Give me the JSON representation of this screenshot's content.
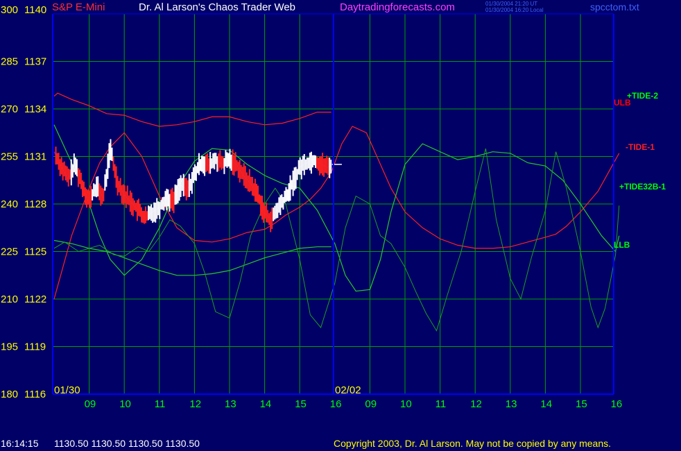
{
  "header": {
    "symbol": "S&P E-Mini",
    "title": "Dr. Al Larson's Chaos Trader Web",
    "site": "Daytradingforecasts.com",
    "ut_time": "01/30/2004 21:20 UT",
    "local_time": "01/30/2004 16:20 Local",
    "filename": "spcctom.txt"
  },
  "footer": {
    "time": "16:14:15",
    "quote": "1130.50 1130.50 1130.50 1130.50",
    "copyright": "Copyright 2003, Dr. Al Larson. May not be copied by any means."
  },
  "colors": {
    "background": "#000066",
    "grid": "#00a000",
    "price_up": "#ffffff",
    "price_down": "#ff2020",
    "tide": "#ff2020",
    "green_line": "#28c828",
    "osc": "#1e9e1e",
    "axis": "#0000ff"
  },
  "chart_data": {
    "type": "line",
    "y_left_labels": [
      "300",
      "285",
      "270",
      "255",
      "240",
      "225",
      "210",
      "195",
      "180"
    ],
    "y_right_labels": [
      "1140",
      "1137",
      "1134",
      "1131",
      "1128",
      "1125",
      "1122",
      "1119",
      "1116"
    ],
    "ylim": [
      1116,
      1140
    ],
    "x_ticks": [
      "09",
      "10",
      "11",
      "12",
      "13",
      "14",
      "15",
      "16",
      "09",
      "10",
      "11",
      "12",
      "13",
      "14",
      "15",
      "16"
    ],
    "date_labels": [
      "01/30",
      "02/02"
    ],
    "line_labels": [
      {
        "text": "+TIDE-2",
        "color": "#00ff00"
      },
      {
        "text": "ULB",
        "color": "#ff0000"
      },
      {
        "text": "-TIDE-1",
        "color": "#ff2020"
      },
      {
        "text": "+TIDE32B-1",
        "color": "#00ff00"
      },
      {
        "text": "LLB",
        "color": "#00ff00"
      }
    ],
    "series": [
      {
        "name": "ULB",
        "x": [
          0,
          0.1,
          0.5,
          1,
          1.5,
          2,
          2.5,
          3,
          3.5,
          4,
          4.5,
          5,
          5.5,
          6,
          6.5,
          7,
          7.5,
          7.9
        ],
        "values": [
          1134.8,
          1135,
          1134.6,
          1134.2,
          1133.7,
          1133.6,
          1133.2,
          1132.9,
          1133,
          1133.2,
          1133.5,
          1133.5,
          1133.2,
          1133,
          1133.1,
          1133.4,
          1133.8,
          1133.8
        ]
      },
      {
        "name": "TIDE-1",
        "x": [
          0,
          0.5,
          1,
          1.3,
          1.6,
          2,
          2.5,
          3,
          3.5,
          4,
          4.5,
          5,
          5.5,
          6,
          6.3,
          6.6,
          7,
          7.3,
          7.6,
          7.9,
          8.2,
          8.5,
          8.9,
          9.2,
          9.6,
          10,
          10.5,
          11,
          11.5,
          12,
          12.5,
          13,
          13.5,
          14,
          14.3,
          14.6,
          15,
          15.5,
          15.8,
          16.1
        ],
        "values": [
          1122,
          1126,
          1129,
          1130.6,
          1131.6,
          1132.5,
          1131,
          1128.5,
          1126.5,
          1125.7,
          1125.6,
          1125.8,
          1126.2,
          1126.4,
          1126.8,
          1127.3,
          1127.8,
          1128.3,
          1129,
          1130,
          1131.8,
          1132.9,
          1132.5,
          1131,
          1129,
          1127.5,
          1126.5,
          1125.8,
          1125.4,
          1125.2,
          1125.2,
          1125.3,
          1125.6,
          1125.9,
          1126.1,
          1126.6,
          1127.5,
          1128.8,
          1130,
          1131.2
        ]
      },
      {
        "name": "LLB",
        "x": [
          0,
          0.5,
          1,
          1.5,
          2,
          2.5,
          3,
          3.5,
          4,
          4.5,
          5,
          5.5,
          6,
          6.5,
          7,
          7.5,
          7.9
        ],
        "values": [
          1125.7,
          1125.5,
          1125.2,
          1125,
          1124.6,
          1124.2,
          1123.8,
          1123.5,
          1123.5,
          1123.6,
          1123.8,
          1124.2,
          1124.6,
          1124.9,
          1125.2,
          1125.3,
          1125.3
        ]
      },
      {
        "name": "TIDE-2",
        "x": [
          0,
          0.5,
          1,
          1.3,
          1.6,
          2,
          2.5,
          3,
          3.5,
          4,
          4.5,
          5,
          5.5,
          6,
          6.5,
          7,
          7.5,
          8,
          8.3,
          8.6,
          9,
          9.3,
          9.6,
          10,
          10.5,
          11,
          11.5,
          12,
          12.5,
          13,
          13.5,
          14,
          14.5,
          15,
          15.3,
          15.6,
          16,
          16.1
        ],
        "values": [
          1133,
          1130.6,
          1128,
          1126,
          1124.5,
          1123.5,
          1124.5,
          1126.5,
          1129,
          1130.7,
          1131.5,
          1131.4,
          1130.5,
          1129.8,
          1129.3,
          1129,
          1127.6,
          1125.5,
          1123.5,
          1122.5,
          1122.6,
          1124.5,
          1127.5,
          1130.5,
          1131.8,
          1131.3,
          1130.8,
          1131,
          1131.3,
          1131.2,
          1130.6,
          1130.4,
          1129.5,
          1128,
          1127,
          1126,
          1125,
          1126
        ]
      },
      {
        "name": "TIDE32B-1",
        "x": [
          0,
          0.3,
          0.7,
          1,
          1.3,
          1.7,
          2,
          2.4,
          2.7,
          3,
          3.3,
          3.6,
          4,
          4.3,
          4.6,
          5,
          5.3,
          5.6,
          6,
          6.3,
          6.6,
          7,
          7.3,
          7.6,
          8,
          8.3,
          8.6,
          9,
          9.3,
          9.6,
          10,
          10.3,
          10.6,
          10.9,
          11.2,
          11.6,
          12,
          12.3,
          12.6,
          13,
          13.3,
          13.6,
          14,
          14.3,
          14.6,
          15,
          15.3,
          15.5,
          15.7,
          16,
          16.1
        ],
        "values": [
          1125.2,
          1125.6,
          1125,
          1125.2,
          1125.4,
          1124.8,
          1124.7,
          1125.3,
          1125,
          1125.9,
          1127,
          1126.6,
          1125.5,
          1123.6,
          1121.2,
          1120.8,
          1123.1,
          1126,
          1128,
          1129,
          1128,
          1124.5,
          1121,
          1120.2,
          1123,
          1126.5,
          1128.5,
          1128,
          1126,
          1125.5,
          1124,
          1122.5,
          1121.1,
          1120,
          1122.2,
          1125,
          1128.8,
          1131.5,
          1127,
          1123.3,
          1122,
          1124.6,
          1127.6,
          1131.3,
          1129,
          1125,
          1121.5,
          1120.2,
          1121.4,
          1124.8,
          1127.9
        ]
      },
      {
        "name": "Price",
        "x": [
          0,
          0.2,
          0.4,
          0.6,
          0.8,
          1,
          1.2,
          1.4,
          1.6,
          1.8,
          2,
          2.2,
          2.4,
          2.6,
          2.8,
          3,
          3.2,
          3.4,
          3.6,
          3.8,
          4,
          4.2,
          4.4,
          4.6,
          4.8,
          5,
          5.2,
          5.4,
          5.6,
          5.8,
          6,
          6.2,
          6.4,
          6.6,
          6.8,
          7,
          7.2,
          7.4,
          7.6,
          7.8,
          7.9
        ],
        "values": [
          1131.3,
          1130.4,
          1129.6,
          1130.5,
          1129.2,
          1128.2,
          1129.1,
          1128.4,
          1131.5,
          1129.4,
          1128.6,
          1128.1,
          1127.6,
          1127.1,
          1127.5,
          1127.8,
          1128.4,
          1128.2,
          1129.2,
          1128.9,
          1129.8,
          1130.7,
          1130.4,
          1130.8,
          1130.5,
          1130.8,
          1130.5,
          1129.8,
          1129.3,
          1128.6,
          1127.4,
          1127,
          1127.8,
          1128.4,
          1129.3,
          1130.3,
          1130.6,
          1130.8,
          1130.5,
          1130.3,
          1130.5
        ]
      }
    ]
  }
}
